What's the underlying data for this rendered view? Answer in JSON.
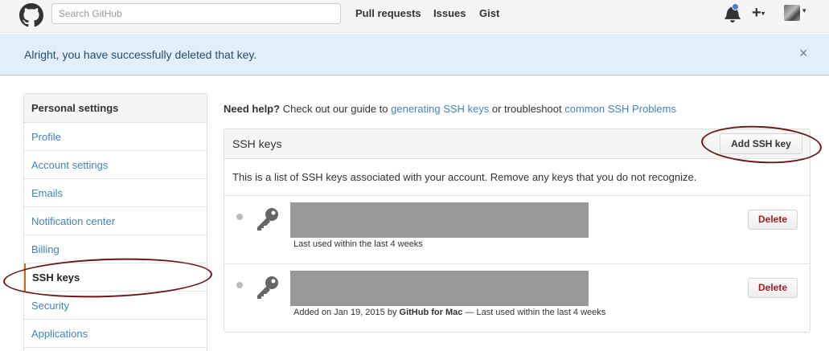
{
  "header": {
    "search_placeholder": "Search GitHub",
    "nav": [
      "Pull requests",
      "Issues",
      "Gist"
    ],
    "icons": [
      "github-logo-icon",
      "bell-icon",
      "plus-icon",
      "avatar"
    ],
    "notification_dot_color": "#4183c4"
  },
  "flash": {
    "message": "Alright, you have successfully deleted that key.",
    "close": "×"
  },
  "sidebar": {
    "heading": "Personal settings",
    "items": [
      {
        "label": "Profile"
      },
      {
        "label": "Account settings"
      },
      {
        "label": "Emails"
      },
      {
        "label": "Notification center"
      },
      {
        "label": "Billing"
      },
      {
        "label": "SSH keys",
        "selected": true
      },
      {
        "label": "Security"
      },
      {
        "label": "Applications"
      }
    ]
  },
  "help": {
    "lead": "Need help?",
    "text1": "Check out our guide to",
    "link1": "generating SSH keys",
    "text2": "or troubleshoot",
    "link2": "common SSH Problems"
  },
  "panel": {
    "title": "SSH keys",
    "add_button": "Add SSH key",
    "description": "This is a list of SSH keys associated with your account. Remove any keys that you do not recognize.",
    "keys": [
      {
        "meta_plain": "Last used within the last 4 weeks",
        "delete": "Delete"
      },
      {
        "meta_prefix": "Added on Jan 19, 2015 by",
        "meta_bold": "GitHub for Mac",
        "meta_suffix": "— Last used within the last 4 weeks",
        "delete": "Delete"
      }
    ]
  },
  "colors": {
    "link": "#4183c4",
    "flash_bg": "#e2eef9",
    "danger": "#a71d1d",
    "annotation": "#6e1414"
  }
}
